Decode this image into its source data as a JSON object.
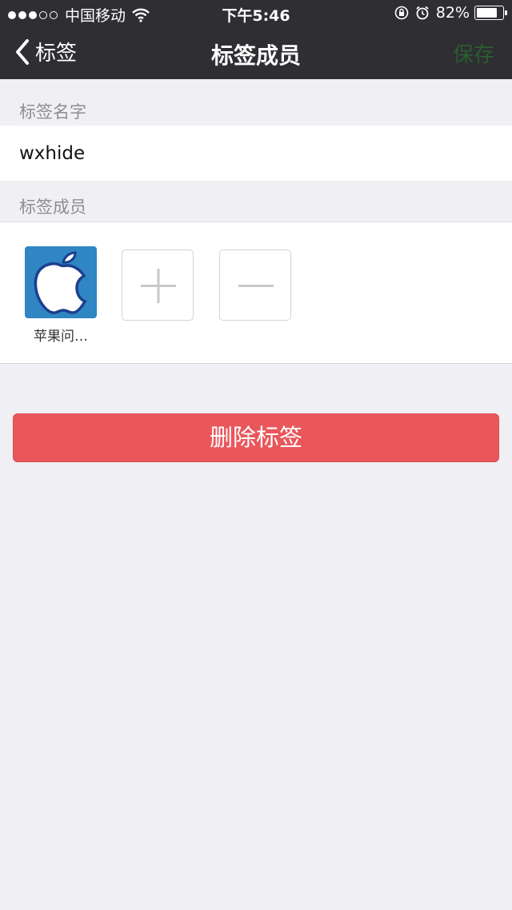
{
  "status_bar": {
    "carrier": "中国移动",
    "time": "下午5:46",
    "battery_percent": "82%",
    "battery_level": 0.82
  },
  "nav": {
    "back_label": "标签",
    "title": "标签成员",
    "save_label": "保存"
  },
  "tag_name_section": {
    "label": "标签名字",
    "value": "wxhide"
  },
  "members_section": {
    "label": "标签成员",
    "members": [
      {
        "name": "苹果问…"
      }
    ]
  },
  "delete_button": {
    "label": "删除标签"
  },
  "colors": {
    "topbar": "#2e2e33",
    "save_text": "#2a5e2e",
    "delete_button": "#e9575b",
    "page_background": "#efeff4",
    "avatar_background": "#2f86c3"
  },
  "icons": {
    "back": "chevron-left-icon",
    "add": "plus-icon",
    "remove": "minus-icon",
    "avatar": "apple-logo-icon"
  }
}
